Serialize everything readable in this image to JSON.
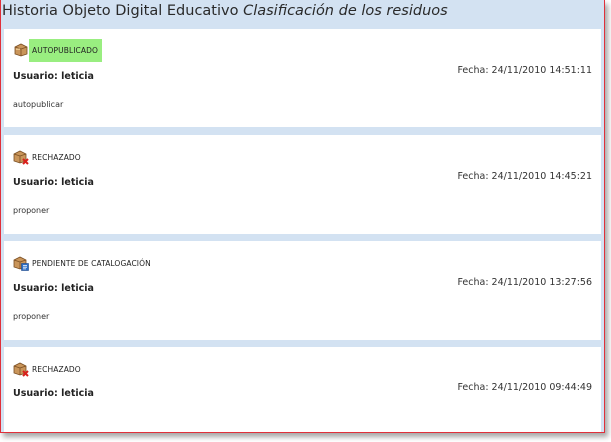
{
  "window": {
    "title_prefix": "Historia Objeto Digital Educativo",
    "title_object": "Clasificación de los residuos"
  },
  "entries": [
    {
      "icon": "box-icon",
      "status": "AUTOPUBLICADO",
      "highlighted": true,
      "user": "Usuario: leticia",
      "date": "Fecha: 24/11/2010 14:51:11",
      "action": "autopublicar"
    },
    {
      "icon": "box-rejected-icon",
      "status": "RECHAZADO",
      "highlighted": false,
      "user": "Usuario: leticia",
      "date": "Fecha: 24/11/2010 14:45:21",
      "action": "proponer"
    },
    {
      "icon": "box-catalog-icon",
      "status": "PENDIENTE DE CATALOGACIÓN",
      "highlighted": false,
      "user": "Usuario: leticia",
      "date": "Fecha: 24/11/2010 13:27:56",
      "action": "proponer"
    },
    {
      "icon": "box-rejected-icon",
      "status": "RECHAZADO",
      "highlighted": false,
      "user": "Usuario: leticia",
      "date": "Fecha: 24/11/2010 09:44:49",
      "action": ""
    }
  ],
  "colors": {
    "band": "#d3e2f2",
    "highlight": "#99ee80",
    "border": "#e0303a"
  }
}
